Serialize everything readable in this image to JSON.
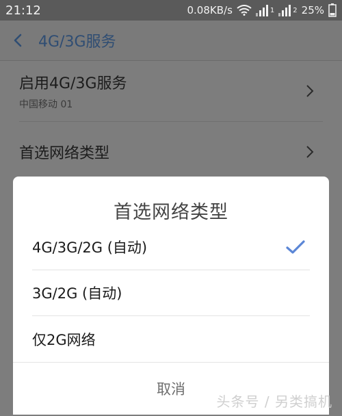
{
  "status_bar": {
    "time": "21:12",
    "network_speed": "0.08KB/s",
    "sim1_index": "1",
    "sim2_index": "2",
    "battery": "25%",
    "icons": [
      "wifi-icon",
      "signal-icon",
      "signal-icon",
      "battery-icon"
    ]
  },
  "header": {
    "title": "4G/3G服务"
  },
  "settings": {
    "items": [
      {
        "label": "启用4G/3G服务",
        "sublabel": "中国移动 01"
      },
      {
        "label": "首选网络类型"
      }
    ]
  },
  "dialog": {
    "title": "首选网络类型",
    "options": [
      {
        "label": "4G/3G/2G (自动)",
        "selected": true
      },
      {
        "label": "3G/2G (自动)",
        "selected": false
      },
      {
        "label": "仅2G网络",
        "selected": false
      }
    ],
    "cancel_label": "取消"
  },
  "watermark": "头条号 / 另类搞机",
  "colors": {
    "accent": "#5b86d6",
    "header_title": "#2f4d73",
    "scrim": "#7d7d7d",
    "dialog_bg": "#ffffff"
  }
}
